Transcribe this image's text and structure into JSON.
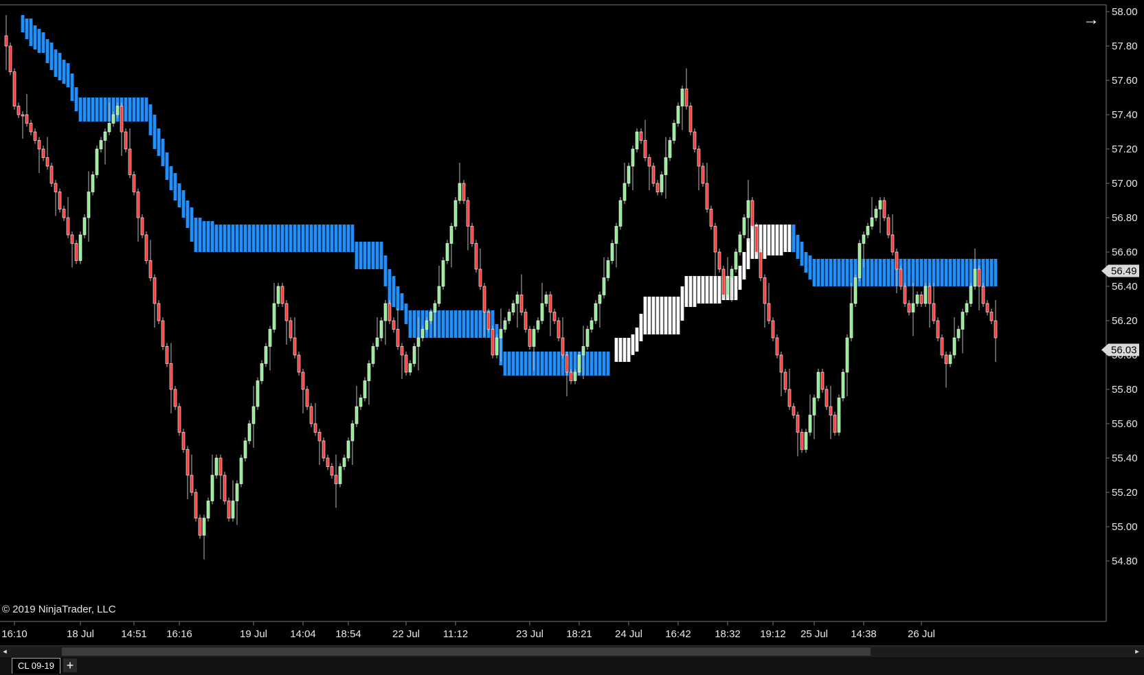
{
  "window": {
    "copyright": "© 2019 NinjaTrader, LLC",
    "instrument_tab": "CL 09-19",
    "add_tab_label": "+",
    "nav_arrow": "→",
    "scroll_left": "◂",
    "scroll_right": "▸"
  },
  "colors": {
    "background": "#000000",
    "candle_up": "#90ee90",
    "candle_down": "#ff3b3b",
    "cloud_blue": "#1e90ff",
    "cloud_white": "#ffffff",
    "axis_text": "#e8e8e8",
    "marker_bg": "#d9d9d9"
  },
  "chart_data": {
    "type": "candlestick",
    "instrument": "CL 09-19",
    "ylim": [
      54.7,
      58.0
    ],
    "price_ticks": [
      "58.00",
      "57.80",
      "57.60",
      "57.40",
      "57.20",
      "57.00",
      "56.80",
      "56.60",
      "56.40",
      "56.20",
      "56.00",
      "55.80",
      "55.60",
      "55.40",
      "55.20",
      "55.00",
      "54.80"
    ],
    "time_labels": [
      "16:10",
      "18 Jul",
      "14:51",
      "16:16",
      "19 Jul",
      "14:04",
      "18:54",
      "22 Jul",
      "11:12",
      "23 Jul",
      "18:21",
      "24 Jul",
      "16:42",
      "18:32",
      "19:12",
      "25 Jul",
      "14:38",
      "26 Jul"
    ],
    "time_label_bar_index": [
      2,
      18,
      31,
      42,
      60,
      72,
      83,
      97,
      109,
      127,
      139,
      151,
      163,
      175,
      186,
      196,
      208,
      222
    ],
    "price_markers": [
      {
        "label": "56.49",
        "value": 56.49
      },
      {
        "label": "56.03",
        "value": 56.03
      }
    ],
    "close_path": [
      [
        0,
        57.81
      ],
      [
        2,
        57.47
      ],
      [
        9,
        57.15
      ],
      [
        17,
        56.55
      ],
      [
        22,
        57.2
      ],
      [
        27,
        57.43
      ],
      [
        47,
        54.93
      ],
      [
        51,
        55.4
      ],
      [
        54,
        55.04
      ],
      [
        66,
        56.4
      ],
      [
        74,
        55.6
      ],
      [
        80,
        55.24
      ],
      [
        92,
        56.3
      ],
      [
        97,
        55.92
      ],
      [
        104,
        56.3
      ],
      [
        110,
        57.01
      ],
      [
        118,
        56.02
      ],
      [
        124,
        56.37
      ],
      [
        127,
        56.06
      ],
      [
        131,
        56.35
      ],
      [
        137,
        55.83
      ],
      [
        145,
        56.45
      ],
      [
        153,
        57.3
      ],
      [
        158,
        56.95
      ],
      [
        164,
        57.54
      ],
      [
        171,
        56.75
      ],
      [
        174,
        56.34
      ],
      [
        180,
        56.88
      ],
      [
        184,
        56.28
      ],
      [
        193,
        55.44
      ],
      [
        197,
        55.88
      ],
      [
        201,
        55.54
      ],
      [
        207,
        56.66
      ],
      [
        212,
        56.88
      ],
      [
        218,
        56.28
      ],
      [
        223,
        56.38
      ],
      [
        228,
        55.93
      ],
      [
        235,
        56.48
      ],
      [
        238,
        56.24
      ],
      [
        240,
        56.12
      ]
    ],
    "cloud_blue": [
      [
        4,
        57.98,
        57.88
      ],
      [
        6,
        57.95,
        57.8
      ],
      [
        9,
        57.88,
        57.75
      ],
      [
        12,
        57.78,
        57.62
      ],
      [
        15,
        57.7,
        57.55
      ],
      [
        18,
        57.5,
        57.35
      ],
      [
        34,
        57.5,
        57.35
      ],
      [
        36,
        57.4,
        57.2
      ],
      [
        38,
        57.25,
        57.1
      ],
      [
        40,
        57.1,
        56.95
      ],
      [
        43,
        56.95,
        56.8
      ],
      [
        46,
        56.8,
        56.6
      ],
      [
        53,
        56.75,
        56.6
      ],
      [
        84,
        56.75,
        56.6
      ],
      [
        85,
        56.65,
        56.5
      ],
      [
        91,
        56.65,
        56.5
      ],
      [
        93,
        56.5,
        56.3
      ],
      [
        96,
        56.35,
        56.25
      ],
      [
        98,
        56.25,
        56.1
      ],
      [
        118,
        56.25,
        56.1
      ],
      [
        121,
        56.02,
        55.87
      ],
      [
        146,
        56.02,
        55.87
      ]
    ],
    "cloud_white": [
      [
        148,
        56.1,
        55.96
      ],
      [
        151,
        56.1,
        55.96
      ],
      [
        153,
        56.15,
        56.02
      ],
      [
        155,
        56.34,
        56.12
      ],
      [
        163,
        56.34,
        56.12
      ],
      [
        165,
        56.45,
        56.28
      ],
      [
        177,
        56.45,
        56.32
      ],
      [
        181,
        56.75,
        56.55
      ],
      [
        191,
        56.75,
        56.6
      ]
    ],
    "cloud_blue_2": [
      [
        191,
        56.75,
        56.6
      ],
      [
        194,
        56.6,
        56.48
      ],
      [
        196,
        56.55,
        56.4
      ],
      [
        240,
        56.55,
        56.4
      ]
    ]
  }
}
